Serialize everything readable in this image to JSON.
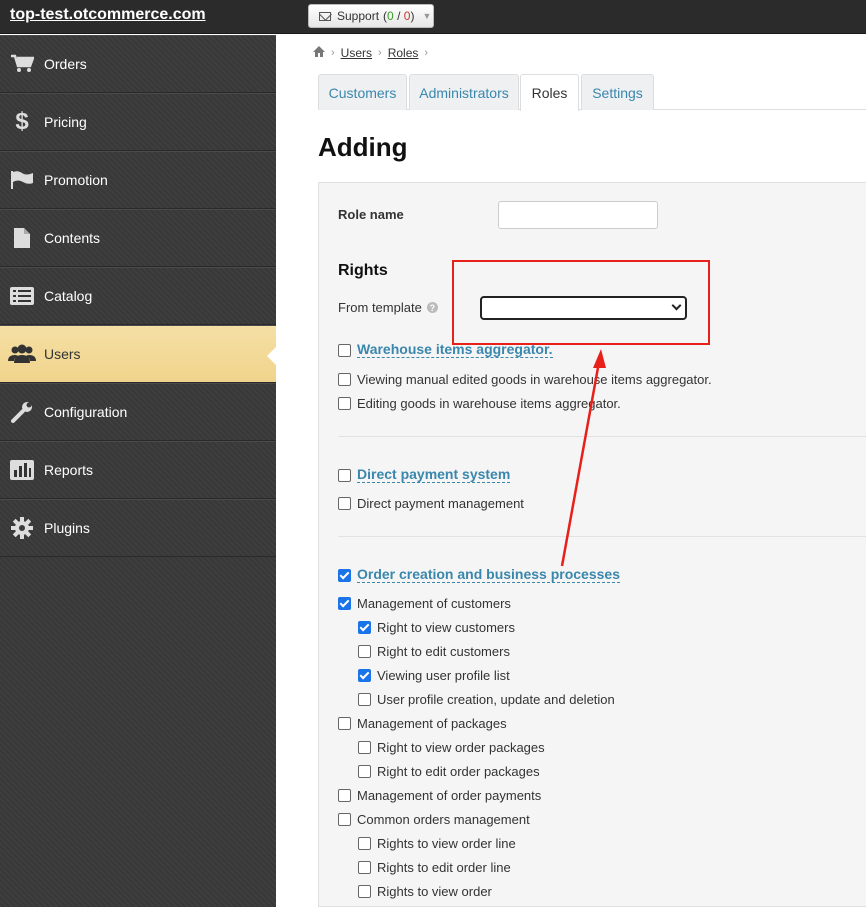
{
  "topbar": {
    "site_title": "top-test.otcommerce.com",
    "support_label": "Support",
    "support_open": "0",
    "support_slash": "/",
    "support_total": "0"
  },
  "sidebar": {
    "items": [
      {
        "label": "Orders",
        "icon": "cart-icon"
      },
      {
        "label": "Pricing",
        "icon": "dollar-icon"
      },
      {
        "label": "Promotion",
        "icon": "flag-icon"
      },
      {
        "label": "Contents",
        "icon": "document-icon"
      },
      {
        "label": "Catalog",
        "icon": "list-icon"
      },
      {
        "label": "Users",
        "icon": "users-icon",
        "active": true
      },
      {
        "label": "Configuration",
        "icon": "wrench-icon"
      },
      {
        "label": "Reports",
        "icon": "chart-icon"
      },
      {
        "label": "Plugins",
        "icon": "gear-icon"
      }
    ]
  },
  "breadcrumb": {
    "home_icon": "home-icon",
    "items": [
      "Users",
      "Roles"
    ]
  },
  "tabs": [
    {
      "label": "Customers"
    },
    {
      "label": "Administrators"
    },
    {
      "label": "Roles",
      "active": true
    },
    {
      "label": "Settings"
    }
  ],
  "page_title": "Adding",
  "form": {
    "role_name_label": "Role name",
    "role_name_value": "",
    "rights_heading": "Rights",
    "from_template_label": "From template",
    "template_value": ""
  },
  "rights": {
    "warehouse": {
      "title": "Warehouse items aggregator.",
      "checked": false,
      "items": [
        {
          "label": "Viewing manual edited goods in warehouse items aggregator.",
          "checked": false
        },
        {
          "label": "Editing goods in warehouse items aggregator.",
          "checked": false
        }
      ]
    },
    "payment": {
      "title": "Direct payment system",
      "checked": false,
      "items": [
        {
          "label": "Direct payment management",
          "checked": false
        }
      ]
    },
    "orders": {
      "title": "Order creation and business processes",
      "checked": true,
      "items": [
        {
          "label": "Management of customers",
          "checked": true,
          "level": 1
        },
        {
          "label": "Right to view customers",
          "checked": true,
          "level": 2
        },
        {
          "label": "Right to edit customers",
          "checked": false,
          "level": 2
        },
        {
          "label": "Viewing user profile list",
          "checked": true,
          "level": 2
        },
        {
          "label": "User profile creation, update and deletion",
          "checked": false,
          "level": 2
        },
        {
          "label": "Management of packages",
          "checked": false,
          "level": 1
        },
        {
          "label": "Right to view order packages",
          "checked": false,
          "level": 2
        },
        {
          "label": "Right to edit order packages",
          "checked": false,
          "level": 2
        },
        {
          "label": "Management of order payments",
          "checked": false,
          "level": 1
        },
        {
          "label": "Common orders management",
          "checked": false,
          "level": 1
        },
        {
          "label": "Rights to view order line",
          "checked": false,
          "level": 2
        },
        {
          "label": "Rights to edit order line",
          "checked": false,
          "level": 2
        },
        {
          "label": "Rights to view order",
          "checked": false,
          "level": 2
        }
      ]
    }
  },
  "annotation": {
    "color": "#e8201a"
  }
}
